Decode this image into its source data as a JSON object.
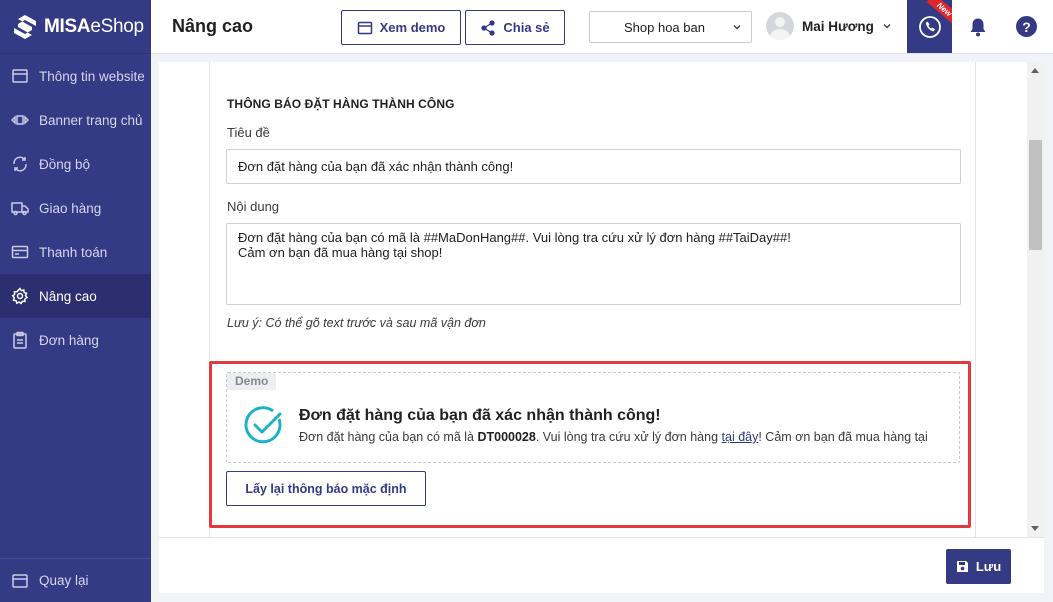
{
  "app": {
    "brand_bold": "MISA",
    "brand_light": "eShop"
  },
  "colors": {
    "primary": "#353a84",
    "highlight": "#e23a3f",
    "success": "#1ab2c4"
  },
  "sidebar": {
    "items": [
      {
        "label": "Thông tin website",
        "icon": "browser-icon"
      },
      {
        "label": "Banner trang chủ",
        "icon": "banner-icon"
      },
      {
        "label": "Đồng bộ",
        "icon": "sync-icon"
      },
      {
        "label": "Giao hàng",
        "icon": "truck-icon"
      },
      {
        "label": "Thanh toán",
        "icon": "payment-icon"
      },
      {
        "label": "Nâng cao",
        "icon": "gear-icon",
        "active": true
      },
      {
        "label": "Đơn hàng",
        "icon": "clipboard-icon"
      }
    ],
    "back_label": "Quay lại"
  },
  "header": {
    "title": "Nâng cao",
    "demo_button": "Xem demo",
    "share_button": "Chia sẻ",
    "shop_select": "Shop hoa ban",
    "user_name": "Mai Hương",
    "new_badge": "New"
  },
  "form": {
    "section_title": "THÔNG BÁO ĐẶT HÀNG THÀNH CÔNG",
    "title_label": "Tiêu đề",
    "title_value": "Đơn đặt hàng của bạn đã xác nhận thành công!",
    "content_label": "Nội dung",
    "content_value": "Đơn đặt hàng của bạn có mã là ##MaDonHang##. Vui lòng tra cứu xử lý đơn hàng ##TaiDay##!\nCảm ơn bạn đã mua hàng tại shop!",
    "note": "Lưu ý: Có thể gõ text trước và sau mã vận đơn"
  },
  "demo": {
    "tag": "Demo",
    "heading": "Đơn đặt hàng của bạn đã xác nhận thành công!",
    "text_before": "Đơn đặt hàng của bạn có mã là ",
    "order_code": "DT000028",
    "text_middle": ". Vui lòng tra cứu xử lý đơn hàng ",
    "link_text": "tại đây",
    "text_after": "! Cảm ơn bạn đã mua hàng tại",
    "reset_button": "Lấy lại thông báo mặc định"
  },
  "footer": {
    "save_button": "Lưu"
  }
}
